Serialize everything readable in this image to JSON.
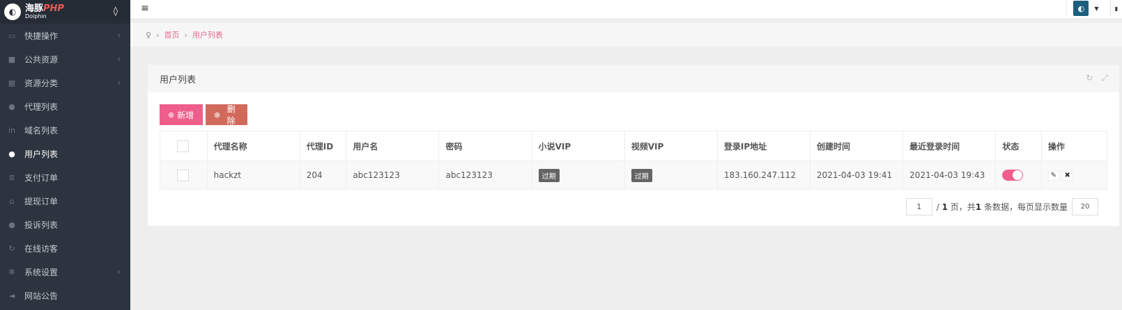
{
  "brand": {
    "cn": "海豚",
    "php": "PHP",
    "en": "Dolphin",
    "dropdown_icon": "droplet-icon"
  },
  "sidebar": {
    "items": [
      {
        "label": "快捷操作",
        "icon": "folder-icon",
        "has_children": true,
        "active": false
      },
      {
        "label": "公共资源",
        "icon": "video-icon",
        "has_children": true,
        "active": false
      },
      {
        "label": "资源分类",
        "icon": "grid-icon",
        "has_children": true,
        "active": false
      },
      {
        "label": "代理列表",
        "icon": "users-icon",
        "has_children": false,
        "active": false
      },
      {
        "label": "域名列表",
        "icon": "linkedin-icon",
        "has_children": false,
        "active": false
      },
      {
        "label": "用户列表",
        "icon": "user-icon",
        "has_children": false,
        "active": true
      },
      {
        "label": "支付订单",
        "icon": "list-icon",
        "has_children": false,
        "active": false
      },
      {
        "label": "提现订单",
        "icon": "bank-icon",
        "has_children": false,
        "active": false
      },
      {
        "label": "投诉列表",
        "icon": "alert-icon",
        "has_children": false,
        "active": false
      },
      {
        "label": "在线访客",
        "icon": "refresh-icon",
        "has_children": false,
        "active": false
      },
      {
        "label": "系统设置",
        "icon": "gear-icon",
        "has_children": true,
        "active": false
      },
      {
        "label": "网站公告",
        "icon": "megaphone-icon",
        "has_children": false,
        "active": false
      }
    ]
  },
  "breadcrumb": {
    "home": "首页",
    "current": "用户列表"
  },
  "panel": {
    "title": "用户列表"
  },
  "toolbar": {
    "add_label": "新增",
    "delete_label": "删除"
  },
  "table": {
    "columns": [
      "代理名称",
      "代理ID",
      "用户名",
      "密码",
      "小说VIP",
      "视频VIP",
      "登录IP地址",
      "创建时间",
      "最近登录时间",
      "状态",
      "操作"
    ],
    "rows": [
      {
        "agent_name": "hackzt",
        "agent_id": "204",
        "username": "abc123123",
        "password": "abc123123",
        "novel_vip": "过期",
        "video_vip": "过期",
        "login_ip": "183.160.247.112",
        "created_at": "2021-04-03 19:41",
        "last_login": "2021-04-03 19:43",
        "status_on": true
      }
    ]
  },
  "pager": {
    "current_page": "1",
    "total_pages_text": "/ 1 页，共",
    "total_count": "1",
    "count_suffix": "条数据，每页显示数量",
    "per_page": "20"
  },
  "colors": {
    "accent": "#ef5e8b",
    "danger": "#d26a5c",
    "sidebar_bg": "#2c343f"
  }
}
